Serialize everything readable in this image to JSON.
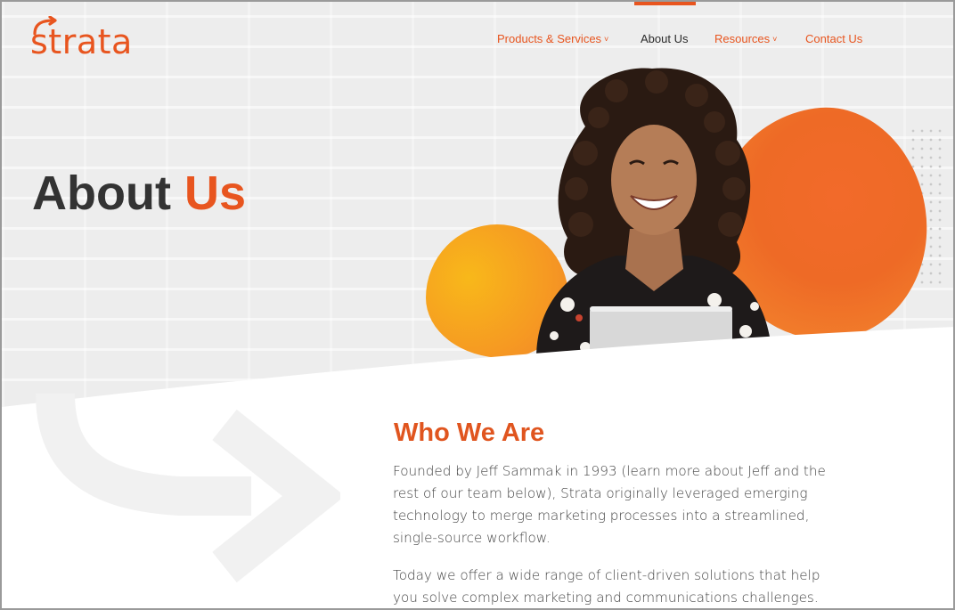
{
  "brand": {
    "logo_text": "strata",
    "accent_color": "#e8551f",
    "secondary_color": "#f6a31f"
  },
  "nav": {
    "items": [
      {
        "label": "Products & Services",
        "has_dropdown": true,
        "active": false
      },
      {
        "label": "About Us",
        "has_dropdown": false,
        "active": true
      },
      {
        "label": "Resources",
        "has_dropdown": true,
        "active": false
      },
      {
        "label": "Contact Us",
        "has_dropdown": false,
        "active": false
      }
    ],
    "dropdown_glyph": "˅"
  },
  "hero": {
    "title_part1": "About",
    "title_part2": "Us"
  },
  "content": {
    "heading": "Who We Are",
    "paragraph1_lines": [
      "Founded by Jeff Sammak in 1993 (learn more about Jeff and the",
      "rest of our team below), Strata originally leveraged emerging",
      "technology to merge marketing processes into a streamlined,",
      "single-source workflow."
    ],
    "paragraph2_lines": [
      "Today we offer a wide range of client-driven solutions that help",
      "you solve complex marketing and communications challenges."
    ]
  },
  "icons": {
    "logo_arrow": "arrow-right-curved-icon",
    "background_arrow": "curved-arrow-icon",
    "dropdown": "chevron-down-icon"
  }
}
